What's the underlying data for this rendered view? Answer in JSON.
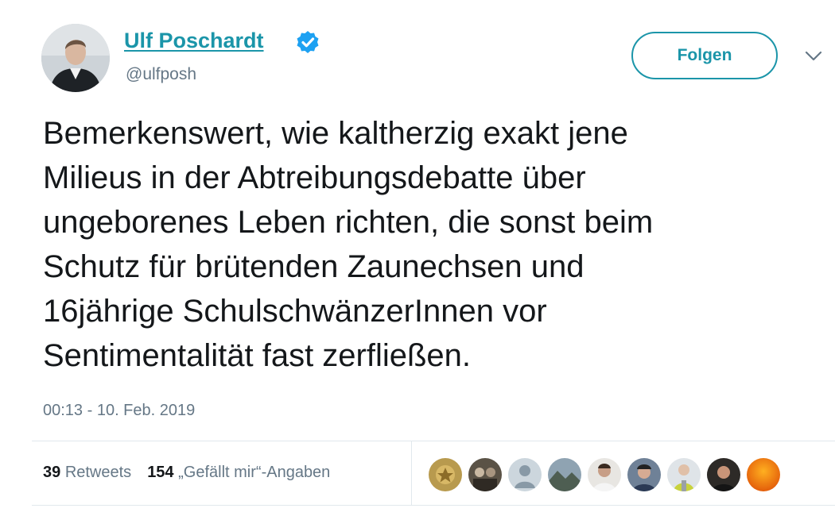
{
  "author": {
    "name": "Ulf Poschardt",
    "handle": "@ulfposh",
    "verified": true
  },
  "follow_button": {
    "label": "Folgen"
  },
  "tweet": {
    "lines": [
      "Bemerkenswert, wie kaltherzig exakt jene",
      "Milieus in der Abtreibungsdebatte über",
      "ungeborenes Leben richten, die sonst beim",
      "Schutz für brütenden Zaunechsen und",
      "16jährige SchulschwänzerInnen vor",
      "Sentimentalität fast zerfließen."
    ],
    "timestamp": "00:13 - 10. Feb. 2019"
  },
  "stats": {
    "retweets_count": "39",
    "retweets_label": "Retweets",
    "likes_count": "154",
    "likes_label": "„Gefällt mir“-Angaben"
  },
  "likers": [
    {
      "icon": "avatar-gold-icon"
    },
    {
      "icon": "avatar-photo-icon"
    },
    {
      "icon": "default-avatar-icon"
    },
    {
      "icon": "avatar-landscape-icon"
    },
    {
      "icon": "avatar-photo-icon"
    },
    {
      "icon": "avatar-photo-icon"
    },
    {
      "icon": "avatar-photo-icon"
    },
    {
      "icon": "avatar-photo-icon"
    },
    {
      "icon": "avatar-orange-icon"
    }
  ],
  "colors": {
    "link": "#1b95a9",
    "verified": "#1da1f2",
    "text": "#14171a",
    "secondary": "#657786",
    "divider": "#e1e8ed"
  }
}
